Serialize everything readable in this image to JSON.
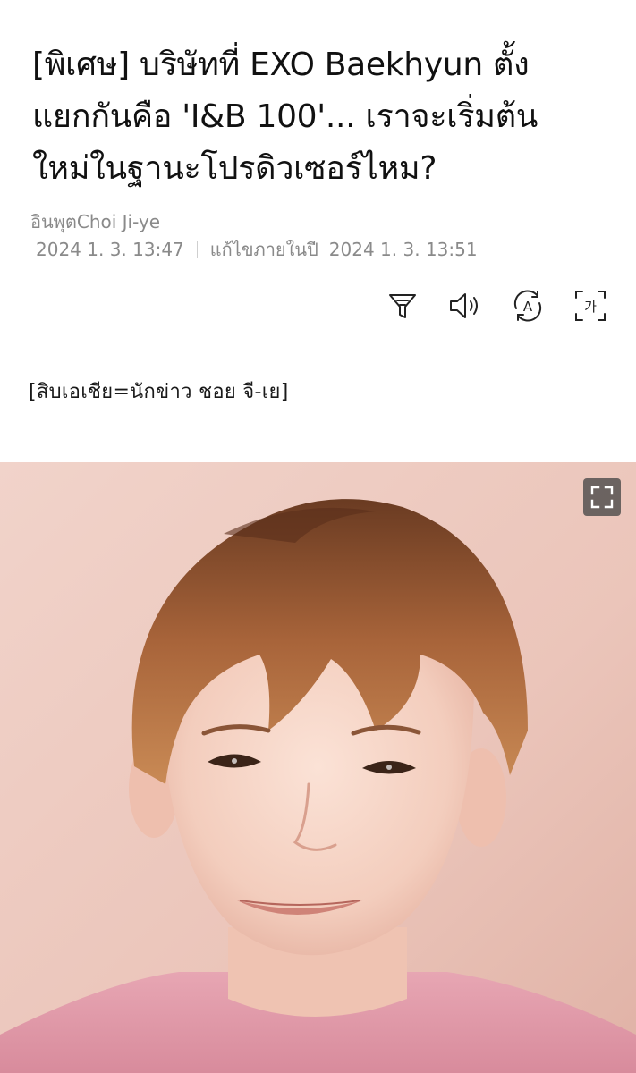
{
  "article": {
    "headline_lines": [
      "[พิเศษ] บริษัทที่ EXO Baekhyun ตั้ง",
      "แยกกันคือ 'I&B 100'... เราจะเริ่มต้น",
      "ใหม่ในฐานะโปรดิวเซอร์ไหม?"
    ],
    "byline": "อินพุตChoi Ji-ye",
    "published": "2024 1. 3. 13:47",
    "edited_label": "แก้ไขภายในปี",
    "edited": "2024 1. 3. 13:51",
    "source_line": "[สิบเอเชีย=นักข่าว ชอย จี-เย]"
  },
  "toolbar": {
    "icons": [
      "summary-filter-icon",
      "speaker-icon",
      "translate-icon",
      "font-size-icon"
    ],
    "font_size_glyph": "가",
    "translate_glyph": "A"
  },
  "photo": {
    "expand_icon": "expand-icon"
  }
}
